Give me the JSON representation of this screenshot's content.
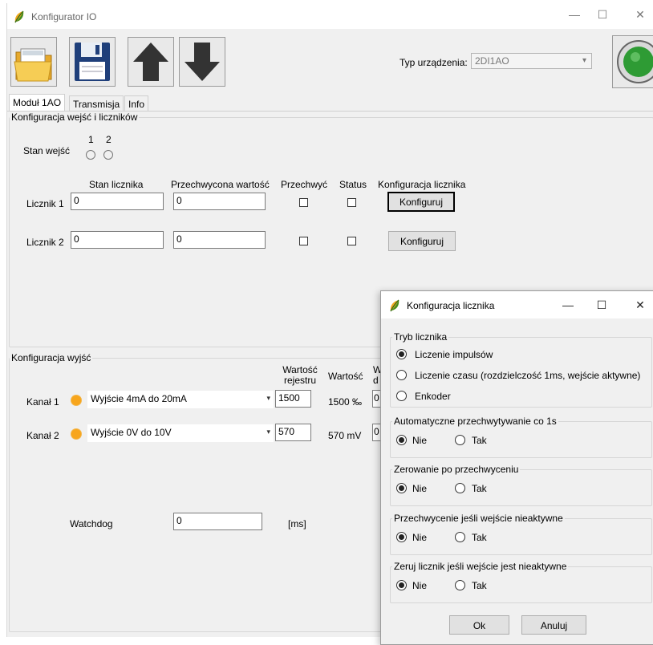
{
  "window": {
    "title": "Konfigurator IO",
    "minimize": "—",
    "maximize": "☐",
    "close": "✕"
  },
  "toolbar": {
    "device_type_label": "Typ urządzenia:",
    "device_type_value": "2DI1AO",
    "dropdown_arrow": "▾"
  },
  "tabs": [
    {
      "label": "Moduł 1AO"
    },
    {
      "label": "Transmisja"
    },
    {
      "label": "Info"
    }
  ],
  "inputs_group": {
    "title": "Konfiguracja wejść i liczników",
    "input_state_label": "Stan wejść",
    "input_numbers": [
      "1",
      "2"
    ],
    "headers": {
      "counter_state": "Stan licznika",
      "captured_value": "Przechwycona wartość",
      "capture": "Przechwyć",
      "status": "Status",
      "counter_config": "Konfiguracja licznika"
    },
    "counters": [
      {
        "label": "Licznik 1",
        "state": "0",
        "captured": "0",
        "button": "Konfiguruj"
      },
      {
        "label": "Licznik 2",
        "state": "0",
        "captured": "0",
        "button": "Konfiguruj"
      }
    ]
  },
  "outputs_group": {
    "title": "Konfiguracja wyjść",
    "header_register_line1": "Wartość",
    "header_register_line2": "rejestru",
    "header_value": "Wartość",
    "header_cut_line1": "W",
    "header_cut_line2": "d",
    "channels": [
      {
        "label": "Kanał 1",
        "mode": "Wyjście 4mA do 20mA",
        "register": "1500",
        "value": "1500 ‰",
        "extra": "0"
      },
      {
        "label": "Kanał 2",
        "mode": "Wyjście 0V do 10V",
        "register": "570",
        "value": "570 mV",
        "extra": "0"
      }
    ],
    "led_color": "#f7a51c"
  },
  "watchdog": {
    "label": "Watchdog",
    "value": "0",
    "unit": "[ms]"
  },
  "dialog": {
    "title": "Konfiguracja licznika",
    "minimize": "—",
    "maximize": "☐",
    "close": "✕",
    "mode_group": {
      "title": "Tryb licznika",
      "options": [
        "Liczenie impulsów",
        "Liczenie czasu (rozdzielczość 1ms, wejście aktywne)",
        "Enkoder"
      ],
      "selected": 0
    },
    "auto_capture": {
      "title": "Automatyczne przechwytywanie co 1s",
      "no": "Nie",
      "yes": "Tak",
      "selected": "no"
    },
    "reset_after_capture": {
      "title": "Zerowanie po przechwyceniu",
      "no": "Nie",
      "yes": "Tak",
      "selected": "no"
    },
    "capture_if_inactive": {
      "title": "Przechwycenie jeśli wejście nieaktywne",
      "no": "Nie",
      "yes": "Tak",
      "selected": "no"
    },
    "reset_if_inactive": {
      "title": "Zeruj licznik jeśli wejście jest nieaktywne",
      "no": "Nie",
      "yes": "Tak",
      "selected": "no"
    },
    "ok": "Ok",
    "cancel": "Anuluj"
  }
}
